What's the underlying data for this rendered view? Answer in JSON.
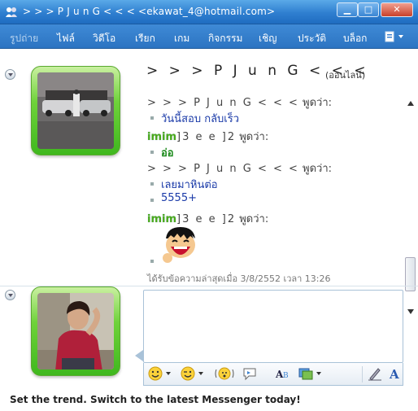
{
  "window": {
    "title": "> > >  P J u n G  < < < <ekawat_4@hotmail.com>",
    "minimize_icon": "minimize-icon",
    "maximize_icon": "maximize-icon",
    "close_icon": "close-icon"
  },
  "menu": {
    "items": [
      {
        "label": "รูปถ่าย",
        "dim": true
      },
      {
        "label": "ไฟล์"
      },
      {
        "label": "วิดีโอ"
      },
      {
        "label": "เรียก"
      },
      {
        "label": "เกม"
      },
      {
        "label": "กิจกรรม"
      },
      {
        "label": "เชิญ"
      },
      {
        "label": "ประวัติ"
      },
      {
        "label": "บล็อก"
      }
    ],
    "more_icon": "toolbar-options-icon"
  },
  "contact": {
    "name": "> > >  P J u n G  < < <",
    "status": "(ออนไลน์)"
  },
  "messages": [
    {
      "sender": "> > >  P J u n G  < < <",
      "says": " พูดว่า:",
      "lines": [
        "วันนี้สอบ กลับเร็ว"
      ]
    },
    {
      "sender_prefix": "imim",
      "sender": "]3 e e ]2",
      "says": " พูดว่า:",
      "lines": [
        "อ่อ"
      ]
    },
    {
      "sender": "> > >  P J u n G  < < <",
      "says": " พูดว่า:",
      "lines": [
        "เลยมาหินต่อ",
        "5555+"
      ]
    },
    {
      "sender_prefix": "imim",
      "sender": "]3 e e ]2",
      "says": " พูดว่า:",
      "emoticon": "laughing-face-emoticon"
    }
  ],
  "received": "ได้รับข้อความล่าสุดเมื่อ 3/8/2552 เวลา 13:26",
  "footer": {
    "ad": "Set the trend. Switch to the latest Messenger today!"
  },
  "colors": {
    "accent": "#2f7fd0",
    "message_text": "#1a3aa8",
    "green_text": "#1a8a1a"
  }
}
